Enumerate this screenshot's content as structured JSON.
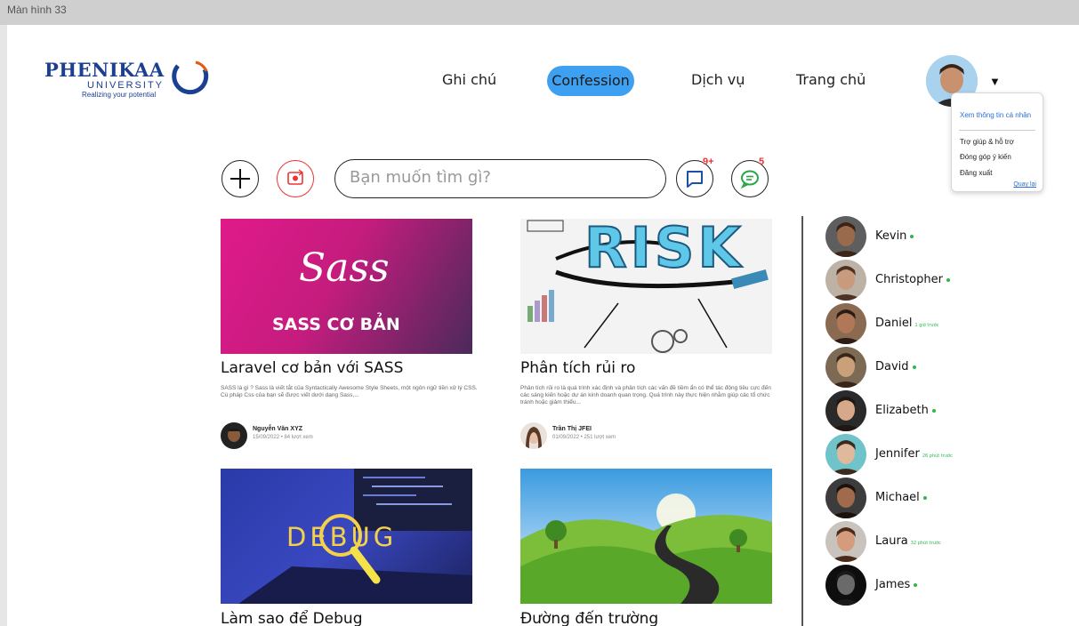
{
  "frame_label": "Màn hình 33",
  "logo": {
    "name": "PHENIKAA",
    "sub": "UNIVERSITY",
    "tagline": "Realizing your potential"
  },
  "nav": {
    "notes": "Ghi chú",
    "confession": "Confession",
    "services": "Dịch vụ",
    "home": "Trang chủ"
  },
  "profile_menu": {
    "view_profile": "Xem thông tin cá nhân",
    "help": "Trợ giúp & hỗ trợ",
    "feedback": "Đóng góp ý kiến",
    "logout": "Đăng xuất",
    "back": "Quay lại"
  },
  "toolbar": {
    "search_placeholder": "Bạn muốn tìm gì?",
    "messages_badge": "9+",
    "chat_badge": "5"
  },
  "posts": [
    {
      "title": "Laravel cơ bản với SASS",
      "image_text_1": "Sass",
      "image_text_2": "SASS CƠ BẢN",
      "desc": "SASS là gì ? Sass là viết tắt của Syntactically Awesome Style Sheets, một ngôn ngữ tiền xử lý CSS. Cú pháp Css của bạn sẽ được viết dưới dạng Sass,...",
      "author": "Nguyễn Văn XYZ",
      "meta": "15/09/2022 • 84 lượt xem"
    },
    {
      "title": "Phân tích rủi ro",
      "image_text_1": "RISK",
      "desc": "Phân tích rủi ro là quá trình xác định và phân tích các vấn đề tiềm ẩn có thể tác động tiêu cực đến các sáng kiến hoặc dự án kinh doanh quan trọng. Quá trình này thực hiện nhằm giúp các tổ chức tránh hoặc giảm thiểu...",
      "author": "Trần Thị JFEI",
      "meta": "01/09/2022 • 251 lượt xem"
    },
    {
      "title": "Làm sao để Debug",
      "image_text_1": "DEBUG"
    },
    {
      "title": "Đường đến trường"
    }
  ],
  "users": [
    {
      "name": "Kevin",
      "status": "online",
      "skin": "#9a6a4c",
      "hair": "#3b2416",
      "bg": "#5e5e5e"
    },
    {
      "name": "Christopher",
      "status": "online",
      "skin": "#c99a7e",
      "hair": "#4d3224",
      "bg": "#bdb2a6"
    },
    {
      "name": "Daniel",
      "status": "1 giờ trước",
      "skin": "#b07856",
      "hair": "#2c1c13",
      "bg": "#8a6a50"
    },
    {
      "name": "David",
      "status": "online",
      "skin": "#caa07a",
      "hair": "#3a2618",
      "bg": "#7c6a55"
    },
    {
      "name": "Elizabeth",
      "status": "online",
      "skin": "#d7a88a",
      "hair": "#1f1714",
      "bg": "#2a2a2a"
    },
    {
      "name": "Jennifer",
      "status": "26 phút trước",
      "skin": "#e0b89c",
      "hair": "#3e2a1c",
      "bg": "#6fc3c9"
    },
    {
      "name": "Michael",
      "status": "online",
      "skin": "#a06a4c",
      "hair": "#1b120c",
      "bg": "#3c3c3c"
    },
    {
      "name": "Laura",
      "status": "32 phút trước",
      "skin": "#d49c7c",
      "hair": "#4a2a18",
      "bg": "#c9c3bd"
    },
    {
      "name": "James",
      "status": "online",
      "skin": "#6a6a6a",
      "hair": "#1a1a1a",
      "bg": "#0e0e0e"
    }
  ]
}
